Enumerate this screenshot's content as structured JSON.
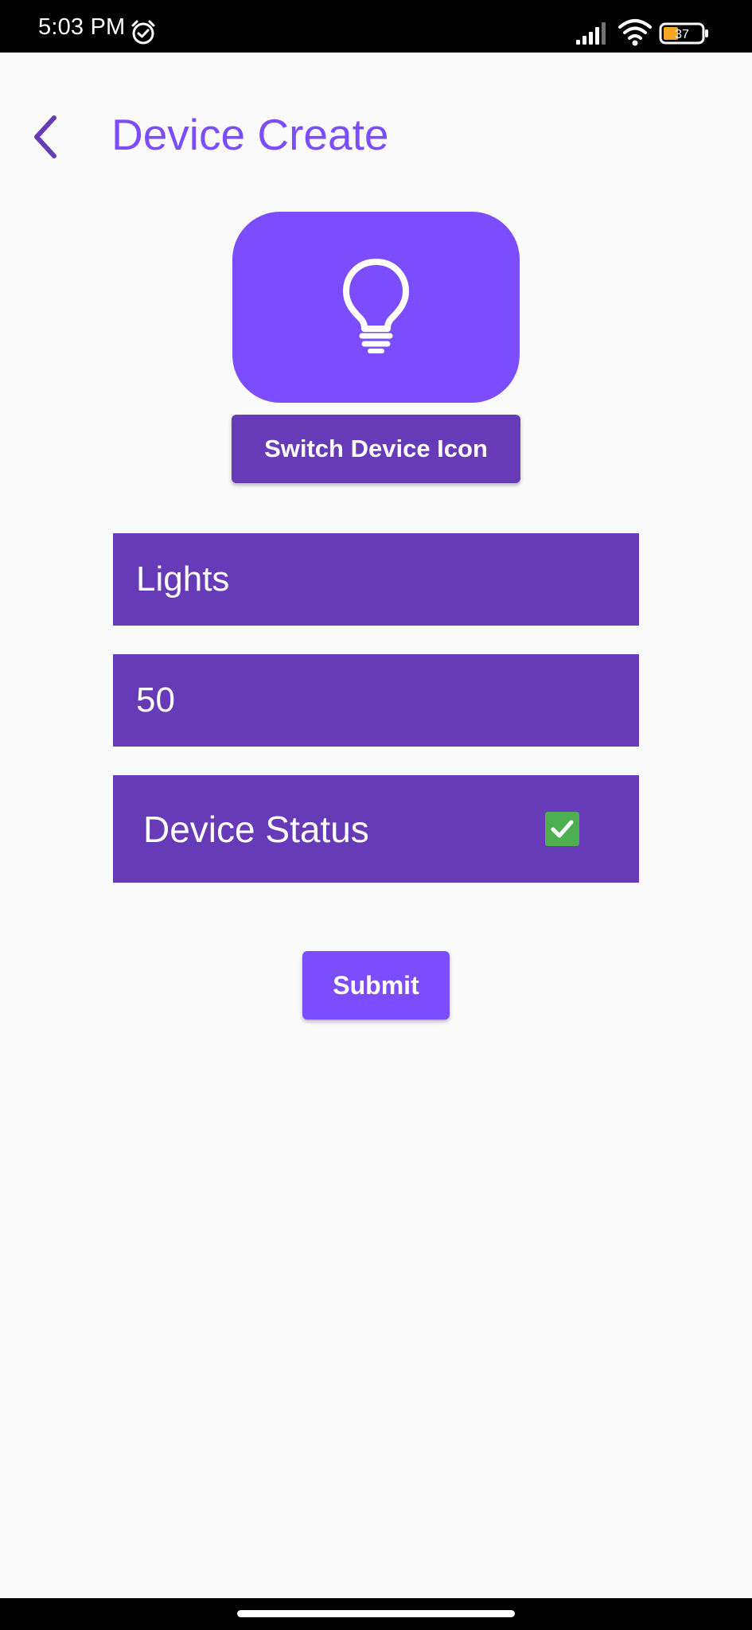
{
  "status_bar": {
    "time": "5:03 PM",
    "battery_level": "37",
    "icons": [
      "alarm-icon",
      "signal-icon",
      "wifi-icon",
      "battery-icon"
    ]
  },
  "header": {
    "title": "Device Create",
    "back_icon": "chevron-left-icon"
  },
  "device_icon": {
    "icon": "lightbulb-icon",
    "switch_label": "Switch Device Icon"
  },
  "form": {
    "name_value": "Lights",
    "value_value": "50",
    "status_label": "Device Status",
    "status_checked": true
  },
  "actions": {
    "submit_label": "Submit"
  },
  "colors": {
    "accent": "#7c4dff",
    "primary_dark": "#673ab7",
    "checkbox": "#4caf50",
    "background": "#fafafa"
  }
}
